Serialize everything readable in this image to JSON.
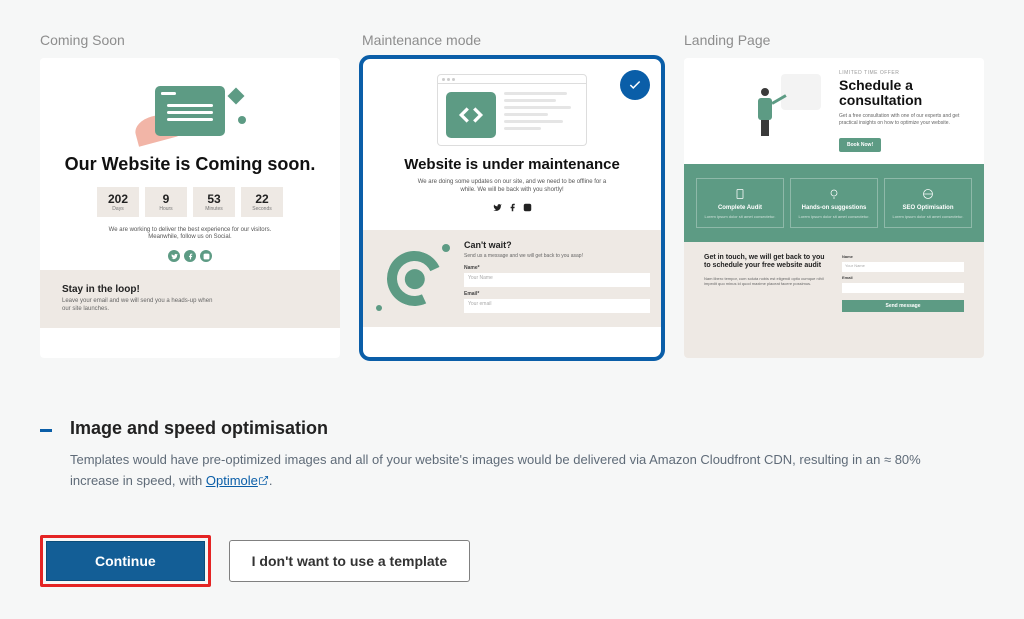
{
  "templates": {
    "t1": {
      "label": "Coming Soon",
      "title": "Our Website is Coming soon.",
      "counts": [
        {
          "value": "202",
          "label": "Days"
        },
        {
          "value": "9",
          "label": "Hours"
        },
        {
          "value": "53",
          "label": "Minutes"
        },
        {
          "value": "22",
          "label": "Seconds"
        }
      ],
      "desc": "We are working to deliver the best experience for our visitors. Meanwhile, follow us on Social.",
      "stay_title": "Stay in the loop!",
      "stay_desc": "Leave your email and we will send you a heads-up when our site launches."
    },
    "t2": {
      "label": "Maintenance mode",
      "title": "Website is under maintenance",
      "desc": "We are doing some updates on our site, and we need to be offline for a while. We will be back with you shortly!",
      "cant_wait": "Can't wait?",
      "form_desc": "Send us a message and we will get back to you asap!",
      "name_label": "Name*",
      "name_ph": "Your Name",
      "email_label": "Email*",
      "email_ph": "Your email"
    },
    "t3": {
      "label": "Landing Page",
      "hero_title": "Schedule a consultation",
      "hero_desc": "Get a free consultation with one of our experts and get practical insights on how to optimize your website.",
      "hero_btn": "Book Now!",
      "features": [
        {
          "title": "Complete Audit"
        },
        {
          "title": "Hands-on suggestions"
        },
        {
          "title": "SEO Optimisation"
        }
      ],
      "contact_title": "Get in touch, we will get back to you to schedule your free website audit",
      "contact_desc": "Nam libero tempor, cum soluta nobis est eligendi optio cumque nihil impedit quo minus id quod maxime placeat facere possimus.",
      "name_label": "Name",
      "name_ph": "Your Name",
      "email_label": "Email",
      "send_btn": "Send message"
    }
  },
  "section": {
    "title": "Image and speed optimisation",
    "desc_prefix": "Templates would have pre-optimized images and all of your website's images would be delivered via Amazon Cloudfront CDN, resulting in an ≈ 80% increase in speed, with ",
    "link": "Optimole",
    "desc_suffix": "."
  },
  "buttons": {
    "continue": "Continue",
    "skip": "I don't want to use a template"
  }
}
